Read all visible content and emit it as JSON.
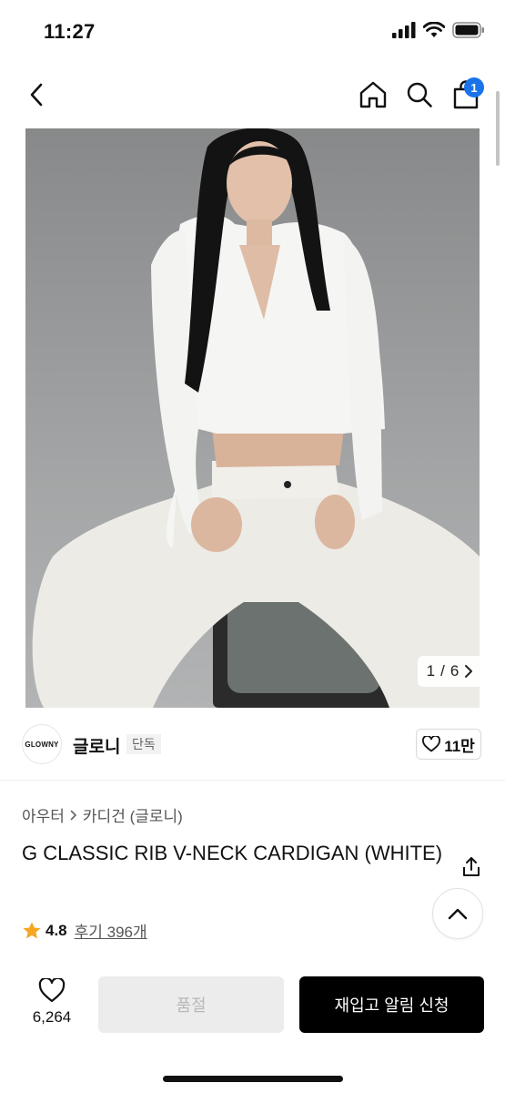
{
  "status_bar": {
    "time": "11:27",
    "icons": [
      "signal-icon",
      "wifi-icon",
      "battery-icon"
    ]
  },
  "nav": {
    "icons": [
      "back-icon",
      "home-icon",
      "search-icon",
      "cart-icon"
    ],
    "cart_badge": "1"
  },
  "hero": {
    "current_index": "1",
    "separator": "/",
    "total": "6"
  },
  "brand": {
    "logo_text": "GLOWNY",
    "name": "글로니",
    "tag": "단독",
    "likes": "11만"
  },
  "product": {
    "breadcrumb": [
      "아우터",
      "카디건 (글로니)"
    ],
    "title": "G CLASSIC RIB V-NECK CARDIGAN (WHITE)",
    "rating": "4.8",
    "review_label": "후기 396개"
  },
  "bottom": {
    "wish_count": "6,264",
    "soldout_label": "품절",
    "restock_label": "재입고 알림 신청"
  },
  "colors": {
    "accent": "#1a73e8",
    "star": "#f5a623",
    "primary_button": "#000000",
    "disabled_button": "#ececec"
  }
}
